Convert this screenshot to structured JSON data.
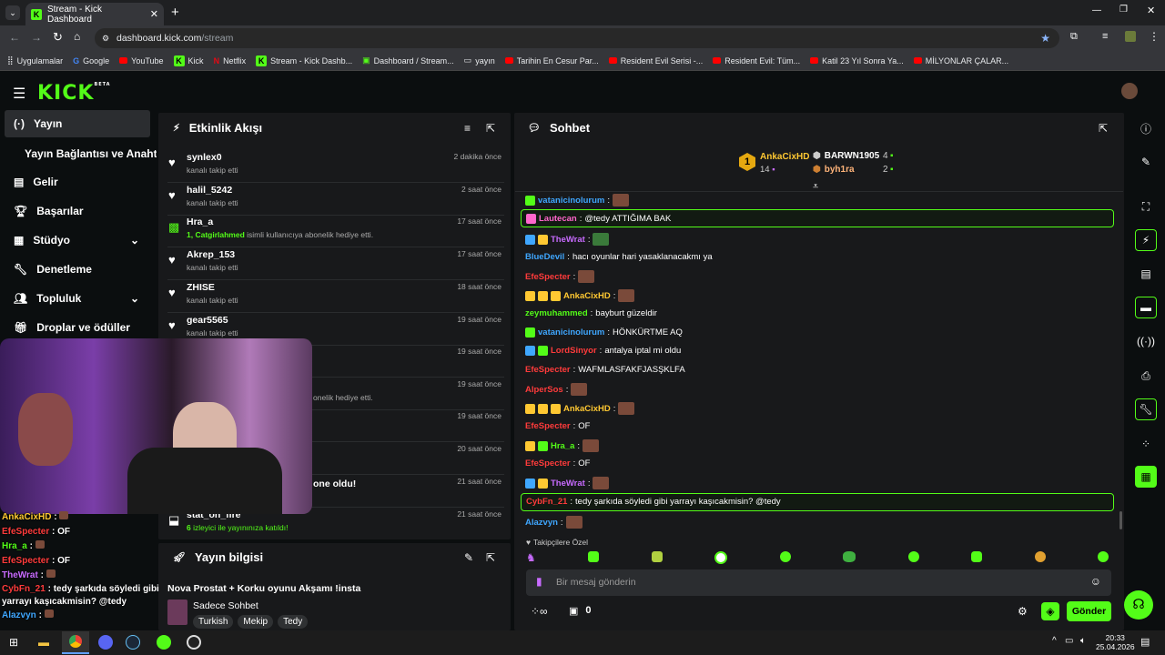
{
  "browser": {
    "tab_title": "Stream - Kick Dashboard",
    "url_host": "dashboard.kick.com",
    "url_path": "/stream",
    "bookmarks": [
      "Uygulamalar",
      "Google",
      "YouTube",
      "Kick",
      "Netflix",
      "Stream - Kick Dashb...",
      "Dashboard / Stream...",
      "yayın",
      "Tarihin En Cesur Par...",
      "Resident Evil Serisi -...",
      "Resident Evil: Tüm...",
      "Katil 23 Yıl Sonra Ya...",
      "MİLYONLAR ÇALAR..."
    ]
  },
  "brand": {
    "logo": "KICK",
    "beta": "BETA",
    "accent": "#53fc18"
  },
  "sidebar": {
    "items": [
      {
        "label": "Yayın",
        "icon": "broadcast-icon"
      },
      {
        "label": "Yayın Bağlantısı ve Anahtarı",
        "icon": ""
      },
      {
        "label": "Gelir",
        "icon": "chart-icon"
      },
      {
        "label": "Başarılar",
        "icon": "trophy-icon"
      },
      {
        "label": "Stüdyo",
        "icon": "studio-icon"
      },
      {
        "label": "Denetleme",
        "icon": "wrench-icon"
      },
      {
        "label": "Topluluk",
        "icon": "people-icon"
      },
      {
        "label": "Droplar ve ödüller",
        "icon": "gift-icon"
      }
    ]
  },
  "activity": {
    "title": "Etkinlik Akışı",
    "items": [
      {
        "name": "synlex0",
        "desc": "kanalı takip etti",
        "time": "2 dakika önce"
      },
      {
        "name": "halil_5242",
        "desc": "kanalı takip etti",
        "time": "2 saat önce"
      },
      {
        "name": "Hra_a",
        "desc_user": "1, Catgirlahmed",
        "desc": "isimli kullanıcıya abonelik hediye etti.",
        "time": "17 saat önce"
      },
      {
        "name": "Akrep_153",
        "desc": "kanalı takip etti",
        "time": "17 saat önce"
      },
      {
        "name": "ZHISE",
        "desc": "kanalı takip etti",
        "time": "18 saat önce"
      },
      {
        "name": "gear5565",
        "desc": "kanalı takip etti",
        "time": "19 saat önce"
      },
      {
        "name": "",
        "desc": "",
        "time": "19 saat önce"
      },
      {
        "name": "",
        "desc": "onelik hediye etti.",
        "time": "19 saat önce"
      },
      {
        "name": "",
        "desc": "",
        "time": "19 saat önce"
      },
      {
        "name": "",
        "desc": "",
        "time": "20 saat önce"
      },
      {
        "name": "one oldu!",
        "desc": "",
        "time": "21 saat önce"
      },
      {
        "name": "stat_on_fire",
        "desc_user": "6",
        "desc": "izleyici ile yayınınıza katıldı!",
        "time": "21 saat önce"
      }
    ]
  },
  "stream_info": {
    "title": "Yayın bilgisi",
    "stream_title": "Nova Prostat + Korku oyunu Akşamı !insta",
    "category": "Sadece Sohbet",
    "tags": [
      "Turkish",
      "Mekip",
      "Tedy"
    ]
  },
  "overlay_chat": [
    {
      "user": "AnkaCixHD",
      "text": ""
    },
    {
      "user": "EfeSpecter",
      "text": "OF"
    },
    {
      "user": "Hra_a",
      "text": ""
    },
    {
      "user": "EfeSpecter",
      "text": "OF"
    },
    {
      "user": "TheWrat",
      "text": ""
    },
    {
      "user": "CybFn_21",
      "text": "tedy şarkıda söyledi gibi yarrayı kaşıcakmisin? @tedy"
    },
    {
      "user": "Alazvyn",
      "text": ""
    }
  ],
  "chat": {
    "title": "Sohbet",
    "leaderboard": {
      "first_user": "AnkaCixHD",
      "first_count": "14",
      "rank": "1",
      "users": [
        {
          "name": "BARWN1905",
          "count": "4"
        },
        {
          "name": "byh1ra",
          "count": "2"
        }
      ]
    },
    "messages": [
      {
        "user": "vatanicinolurum",
        "color": "#3fa7ff",
        "text": "",
        "emote": true
      },
      {
        "user": "Lautecan",
        "color": "#ff66cc",
        "text": "@tedy ATTIĞIMA BAK",
        "hl": true
      },
      {
        "user": "TheWrat",
        "color": "#c86bff",
        "text": "",
        "emote": true
      },
      {
        "user": "BlueDevil",
        "color": "#3fa7ff",
        "text": "hacı oyunlar hari yasaklanacakmı ya"
      },
      {
        "user": "EfeSpecter",
        "color": "#ff3b3b",
        "text": "",
        "emote": true
      },
      {
        "user": "AnkaCixHD",
        "color": "#ffc832",
        "text": "",
        "emote": true
      },
      {
        "user": "zeymuhammed",
        "color": "#53fc18",
        "text": "bayburt güzeldir"
      },
      {
        "user": "vatanicinolurum",
        "color": "#3fa7ff",
        "text": "HÖNKÜRTME AQ"
      },
      {
        "user": "LordSinyor",
        "color": "#ff3b3b",
        "text": "antalya iptal mi oldu"
      },
      {
        "user": "EfeSpecter",
        "color": "#ff3b3b",
        "text": "WAFMLASFAKFJASŞKLFA"
      },
      {
        "user": "AlperSos",
        "color": "#ff3b3b",
        "text": "",
        "emote": true
      },
      {
        "user": "AnkaCixHD",
        "color": "#ffc832",
        "text": "",
        "emote": true
      },
      {
        "user": "EfeSpecter",
        "color": "#ff3b3b",
        "text": "OF"
      },
      {
        "user": "Hra_a",
        "color": "#53fc18",
        "text": "",
        "emote": true
      },
      {
        "user": "EfeSpecter",
        "color": "#ff3b3b",
        "text": "OF"
      },
      {
        "user": "TheWrat",
        "color": "#c86bff",
        "text": "",
        "emote": true
      },
      {
        "user": "CybFn_21",
        "color": "#ff3b3b",
        "text": "tedy şarkıda söyledi gibi yarrayı kaşıcakmisin? @tedy",
        "hl": true
      },
      {
        "user": "Alazvyn",
        "color": "#3fa7ff",
        "text": "",
        "emote": true
      }
    ],
    "followers_only": "Takipçilere Özel",
    "input_placeholder": "Bir mesaj gönderin",
    "points": "0",
    "send": "Gönder"
  },
  "taskbar": {
    "time": "20:33",
    "date": "25.04.2026"
  }
}
